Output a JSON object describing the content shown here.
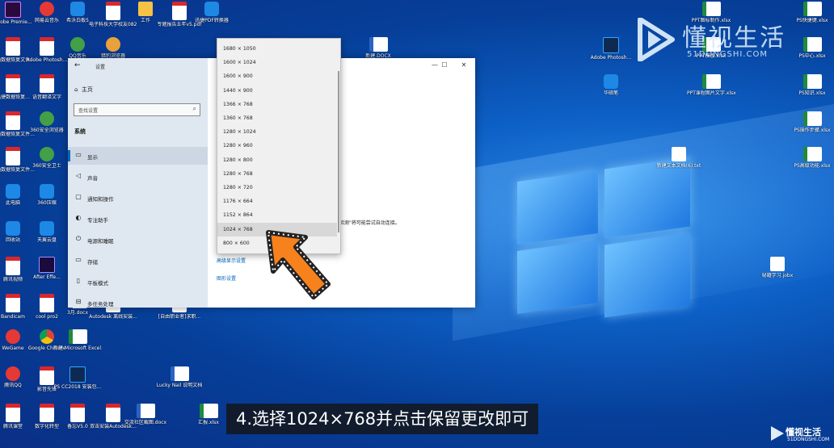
{
  "desktop": {
    "icons_left": [
      {
        "label": "Adobe Premie...",
        "kind": "pr"
      },
      {
        "label": "网易云音乐",
        "kind": "red"
      },
      {
        "label": "希沃白板5",
        "kind": "blue"
      },
      {
        "label": "电子科技大学校友082...",
        "kind": "pdf"
      },
      {
        "label": "工作",
        "kind": "folder"
      },
      {
        "label": "专题报告五年v5.pdf",
        "kind": "pdf"
      },
      {
        "label": "迅捷PDF转换器",
        "kind": "blue"
      },
      {
        "label": "金山数据恢复文件...",
        "kind": "pdf"
      },
      {
        "label": "Adobe Photosh...",
        "kind": "pdf"
      },
      {
        "label": "QQ音乐",
        "kind": "green"
      },
      {
        "label": "猎豹浏览器",
        "kind": "app"
      },
      {
        "label": "迅捷数据恢复...",
        "kind": "pdf"
      },
      {
        "label": "语音翻译文字",
        "kind": "pdf"
      },
      {
        "label": "金山数据恢复文件...",
        "kind": "pdf"
      },
      {
        "label": "360安全浏览器",
        "kind": "green"
      },
      {
        "label": "金山数据恢复文件...",
        "kind": "pdf"
      },
      {
        "label": "360安全卫士",
        "kind": "green"
      },
      {
        "label": "此电脑",
        "kind": "blue"
      },
      {
        "label": "360压缩",
        "kind": "blue"
      },
      {
        "label": "回收站",
        "kind": "blue"
      },
      {
        "label": "天翼云盘",
        "kind": "blue"
      },
      {
        "label": "腾讯视频",
        "kind": "pdf"
      },
      {
        "label": "After Effe...",
        "kind": "ae"
      },
      {
        "label": "Bandicam",
        "kind": "pdf"
      },
      {
        "label": "cool pro2",
        "kind": "pdf"
      },
      {
        "label": "WeGame",
        "kind": "red"
      },
      {
        "label": "Google Chrome",
        "kind": "chrome"
      },
      {
        "label": "新建 Microsoft Excel...",
        "kind": "xls"
      },
      {
        "label": "腾讯QQ",
        "kind": "red"
      },
      {
        "label": "影音先锋",
        "kind": "pdf"
      },
      {
        "label": "PS CC2018 安装包...",
        "kind": "ps"
      },
      {
        "label": "腾讯课堂",
        "kind": "pdf"
      },
      {
        "label": "数字化转型",
        "kind": "pdf"
      },
      {
        "label": "备忘V5.0",
        "kind": "pdf"
      },
      {
        "label": "双击安装Autodesk...",
        "kind": "pdf"
      },
      {
        "label": "交流社区截图.docx",
        "kind": "doc"
      },
      {
        "label": "3月.docx",
        "kind": "doc"
      },
      {
        "label": "Autodesk 离线安装...",
        "kind": "pdf"
      },
      {
        "label": "[自由职业者]求职...",
        "kind": "pdf"
      },
      {
        "label": "Lucky Nail 说明文档",
        "kind": "doc"
      },
      {
        "label": "汇报.xlsx",
        "kind": "xls"
      }
    ],
    "icons_right": [
      {
        "label": "PS快捷键.xlsx",
        "kind": "xls"
      },
      {
        "label": "PS中心.xlsx",
        "kind": "xls"
      },
      {
        "label": "PS知识.xlsx",
        "kind": "xls"
      },
      {
        "label": "PS操作步骤.xlsx",
        "kind": "xls"
      },
      {
        "label": "PS高级功能.xlsx",
        "kind": "xls"
      },
      {
        "label": "PPT图标制作.xlsx",
        "kind": "xls"
      },
      {
        "label": "PPT模板.xlsx",
        "kind": "xls"
      },
      {
        "label": "PPT课程图片文字.xlsx",
        "kind": "xls"
      },
      {
        "label": "Adobe Photosh...",
        "kind": "ps"
      },
      {
        "label": "华硕笔",
        "kind": "blue"
      },
      {
        "label": "新建文本文档(6).txt",
        "kind": "txt"
      },
      {
        "label": "新建.DOCX",
        "kind": "doc"
      },
      {
        "label": "秘籍学习.jobx",
        "kind": "txt"
      }
    ]
  },
  "settings": {
    "window_title": "设置",
    "back_glyph": "←",
    "home_label": "主页",
    "search_placeholder": "查找设置",
    "section_label": "系统",
    "nav": [
      {
        "icon": "▭",
        "label": "显示",
        "active": true
      },
      {
        "icon": "◁",
        "label": "声音"
      },
      {
        "icon": "▢",
        "label": "通知和操作"
      },
      {
        "icon": "◐",
        "label": "专注助手"
      },
      {
        "icon": "⏻",
        "label": "电源和睡眠"
      },
      {
        "icon": "▭",
        "label": "存储"
      },
      {
        "icon": "▯",
        "label": "平板模式"
      },
      {
        "icon": "⊟",
        "label": "多任务处理"
      }
    ],
    "content_text": "检测\"将可能尝试自动连接。",
    "link_advanced": "高级显示设置",
    "link_graphics": "图形设置",
    "btn_min": "—",
    "btn_max": "☐",
    "btn_close": "✕"
  },
  "resolution_dropdown": {
    "options": [
      "1680 × 1050",
      "1600 × 1024",
      "1600 × 900",
      "1440 × 900",
      "1366 × 768",
      "1360 × 768",
      "1280 × 1024",
      "1280 × 960",
      "1280 × 800",
      "1280 × 768",
      "1280 × 720",
      "1176 × 664",
      "1152 × 864",
      "1024 × 768",
      "800 × 600"
    ],
    "selected": "1024 × 768"
  },
  "brand": {
    "name": "懂视生活",
    "url": "51DONGSHI.COM"
  },
  "subtitle": "4.选择1024×768并点击保留更改即可",
  "watermark": {
    "name": "懂视生活",
    "url": "51DONGSHI.COM"
  },
  "colors": {
    "accent": "#0067c0",
    "arrow": "#f7811d"
  }
}
